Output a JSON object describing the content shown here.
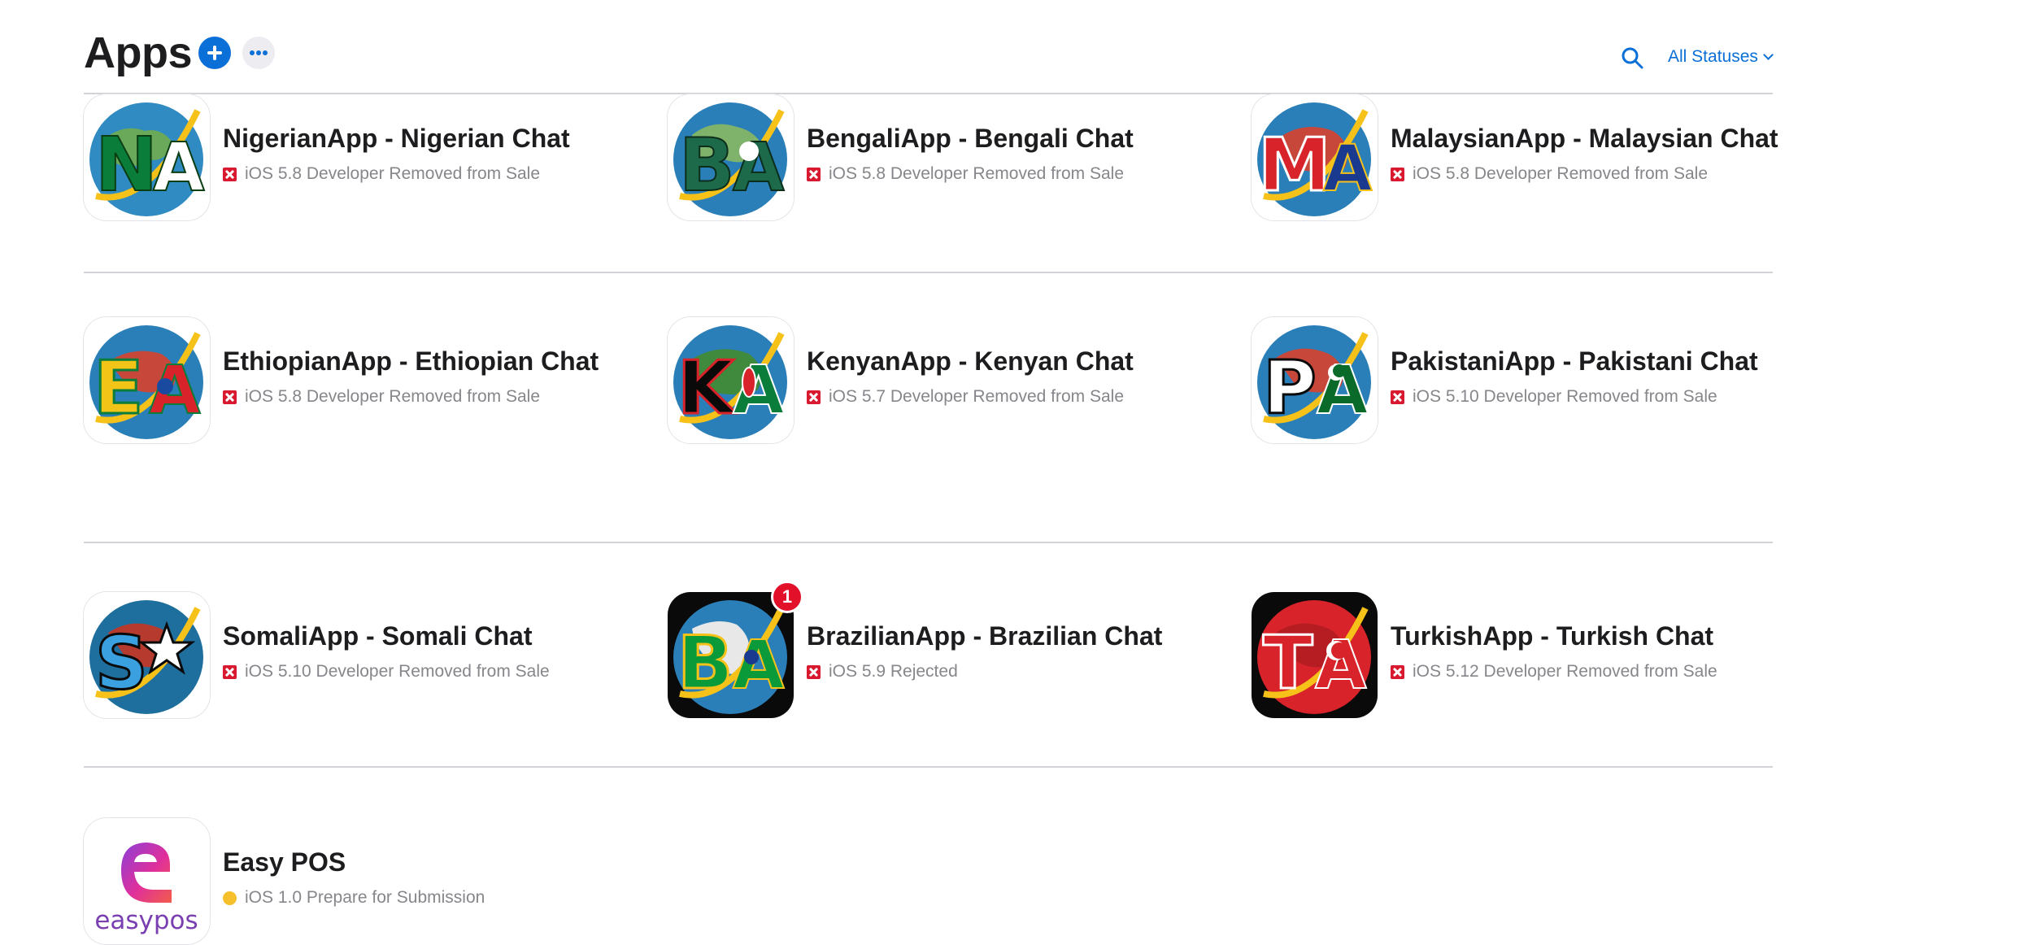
{
  "header": {
    "title": "Apps",
    "add_icon": "plus-icon",
    "more_icon": "ellipsis-icon",
    "search_icon": "search-icon",
    "status_filter_label": "All Statuses"
  },
  "colors": {
    "accent": "#0a6fd6",
    "removed": "#d8192f",
    "pending": "#f5c02b",
    "badge": "#e3102a"
  },
  "apps": [
    {
      "name": "NigerianApp - Nigerian Chat",
      "status": "iOS 5.8 Developer Removed from Sale",
      "status_icon": "removed-x-icon",
      "icon_letters": "NA"
    },
    {
      "name": "BengaliApp - Bengali Chat",
      "status": "iOS 5.8 Developer Removed from Sale",
      "status_icon": "removed-x-icon",
      "icon_letters": "BA"
    },
    {
      "name": "MalaysianApp - Malaysian Chat",
      "status": "iOS 5.8 Developer Removed from Sale",
      "status_icon": "removed-x-icon",
      "icon_letters": "MA"
    },
    {
      "name": "EthiopianApp - Ethiopian Chat",
      "status": "iOS 5.8 Developer Removed from Sale",
      "status_icon": "removed-x-icon",
      "icon_letters": "EA"
    },
    {
      "name": "KenyanApp - Kenyan Chat",
      "status": "iOS 5.7 Developer Removed from Sale",
      "status_icon": "removed-x-icon",
      "icon_letters": "KA"
    },
    {
      "name": "PakistaniApp - Pakistani Chat",
      "status": "iOS 5.10 Developer Removed from Sale",
      "status_icon": "removed-x-icon",
      "icon_letters": "PA"
    },
    {
      "name": "SomaliApp - Somali Chat",
      "status": "iOS 5.10 Developer Removed from Sale",
      "status_icon": "removed-x-icon",
      "icon_letters": "SA"
    },
    {
      "name": "BrazilianApp - Brazilian Chat",
      "status": "iOS 5.9 Rejected",
      "status_icon": "removed-x-icon",
      "icon_letters": "BA",
      "badge": "1"
    },
    {
      "name": "TurkishApp - Turkish Chat",
      "status": "iOS 5.12 Developer Removed from Sale",
      "status_icon": "removed-x-icon",
      "icon_letters": "TA"
    },
    {
      "name": "Easy POS",
      "status": "iOS 1.0 Prepare for Submission",
      "status_icon": "pending-dot-icon",
      "icon_wordmark": "easypos"
    }
  ]
}
